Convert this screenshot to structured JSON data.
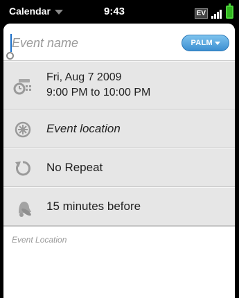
{
  "status_bar": {
    "app_name": "Calendar",
    "time": "9:43",
    "network": "EV"
  },
  "event": {
    "name_placeholder": "Event name",
    "calendar_label": "PALM",
    "date": "Fri, Aug 7 2009",
    "time_range": "9:00 PM to 10:00 PM",
    "location_placeholder": "Event location",
    "repeat": "No Repeat",
    "alarm": "15 minutes before",
    "notes_placeholder": "Event Location"
  },
  "icons": {
    "time": "clock-calendar-icon",
    "location": "location-compass-icon",
    "repeat": "repeat-arrow-icon",
    "alarm": "bell-icon"
  },
  "colors": {
    "accent": "#3d8fd1",
    "battery": "#32b520"
  }
}
